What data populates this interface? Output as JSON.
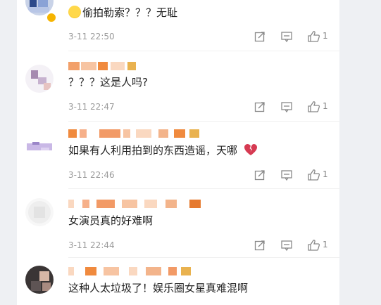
{
  "comments": [
    {
      "text": "偷拍勒索？？？无耻",
      "time": "3-11 22:50",
      "likes": "1",
      "emoji": "grimace-emoji"
    },
    {
      "text": "？？？这是人吗?",
      "time": "3-11 22:47",
      "likes": "1"
    },
    {
      "text": "如果有人利用拍到的东西造谣，天哪",
      "time": "3-11 22:46",
      "likes": "1",
      "emoji": "broken-heart-icon"
    },
    {
      "text": "女演员真的好难啊",
      "time": "3-11 22:44",
      "likes": "1"
    },
    {
      "text": "这种人太垃圾了！娱乐圈女星真难混啊",
      "time": "",
      "likes": ""
    }
  ],
  "icons": {
    "share": "share-icon",
    "reply": "comment-icon",
    "like": "thumbs-up-icon"
  },
  "colors": {
    "accent_orange": "#f08a3e",
    "badge_yellow": "#f6b400",
    "text_gray": "#9a9a9a"
  }
}
